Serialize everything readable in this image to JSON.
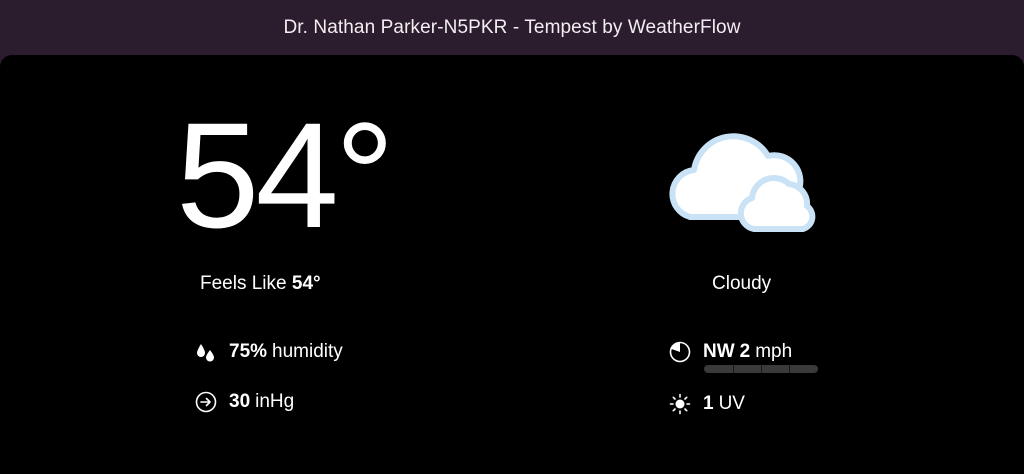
{
  "window": {
    "title": "Dr. Nathan Parker-N5PKR - Tempest by WeatherFlow"
  },
  "current": {
    "temperature": "54°",
    "feels_like_label": "Feels Like",
    "feels_like_value": "54°",
    "condition": "Cloudy",
    "condition_icon": "cloud-icon"
  },
  "humidity": {
    "value": "75%",
    "unit": "humidity",
    "icon": "droplets-icon"
  },
  "pressure": {
    "value": "30",
    "unit": "inHg",
    "icon": "arrow-right-circle-icon"
  },
  "wind": {
    "direction": "NW",
    "speed": "2",
    "unit": "mph",
    "icon": "wind-direction-icon",
    "level_fraction": 0.0
  },
  "uv": {
    "value": "1",
    "unit": "UV",
    "icon": "sun-icon"
  },
  "colors": {
    "background": "#000000",
    "titlebar": "#2b1d2d",
    "cloud_fill": "#ffffff",
    "cloud_outline": "#c9e2f5"
  }
}
